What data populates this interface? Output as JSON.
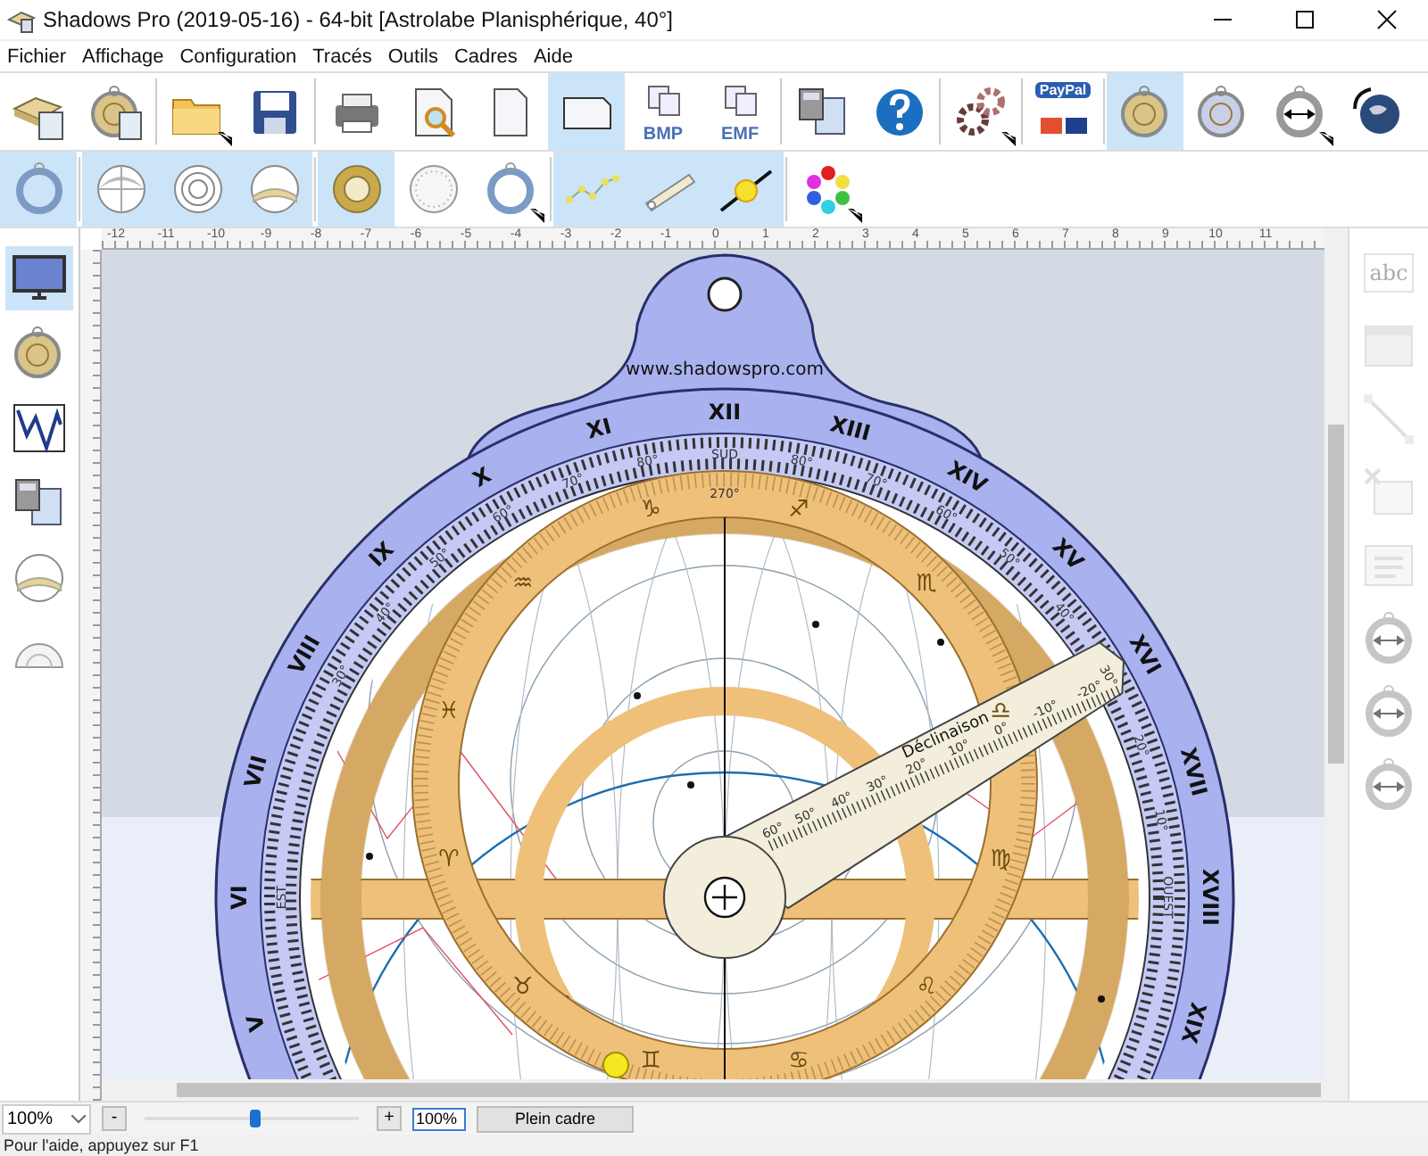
{
  "window": {
    "title": "Shadows Pro (2019-05-16) - 64-bit [Astrolabe Planisphérique, 40°]"
  },
  "menu": [
    "Fichier",
    "Affichage",
    "Configuration",
    "Tracés",
    "Outils",
    "Cadres",
    "Aide"
  ],
  "toolbar_main": [
    [
      {
        "kind": "new-stack",
        "selected": false,
        "dropdown": false
      },
      {
        "kind": "new-astrolabe",
        "selected": false,
        "dropdown": false
      }
    ],
    [
      {
        "kind": "open",
        "selected": false,
        "dropdown": true
      },
      {
        "kind": "save",
        "selected": false,
        "dropdown": false
      }
    ],
    [
      {
        "kind": "print",
        "selected": false,
        "dropdown": false
      },
      {
        "kind": "preview",
        "selected": false,
        "dropdown": false
      },
      {
        "kind": "page-portrait",
        "selected": false,
        "dropdown": false
      },
      {
        "kind": "page-landscape",
        "selected": true,
        "dropdown": false
      },
      {
        "kind": "export",
        "label": "BMP",
        "selected": false,
        "dropdown": false
      },
      {
        "kind": "export",
        "label": "EMF",
        "selected": false,
        "dropdown": false
      }
    ],
    [
      {
        "kind": "calculator",
        "selected": false,
        "dropdown": false
      },
      {
        "kind": "help",
        "selected": false,
        "dropdown": false
      }
    ],
    [
      {
        "kind": "settings",
        "selected": false,
        "dropdown": true
      }
    ],
    [
      {
        "kind": "donate",
        "label": "PayPal",
        "selected": false,
        "dropdown": false
      }
    ],
    [
      {
        "kind": "astrolabe-front",
        "selected": true,
        "dropdown": false
      },
      {
        "kind": "astrolabe-back",
        "selected": false,
        "dropdown": false
      },
      {
        "kind": "resize",
        "selected": false,
        "dropdown": true
      },
      {
        "kind": "globe",
        "selected": false,
        "dropdown": false
      }
    ]
  ],
  "toolbar_layers": [
    [
      {
        "kind": "ring",
        "selected": true,
        "dropdown": false
      }
    ],
    [
      {
        "kind": "hemisphere",
        "selected": true,
        "dropdown": false
      },
      {
        "kind": "circles",
        "selected": true,
        "dropdown": false
      },
      {
        "kind": "dome",
        "selected": true,
        "dropdown": false
      }
    ],
    [
      {
        "kind": "rete",
        "selected": true,
        "dropdown": false
      },
      {
        "kind": "disc",
        "selected": false,
        "dropdown": false
      },
      {
        "kind": "ring",
        "selected": false,
        "dropdown": true
      }
    ],
    [
      {
        "kind": "stars",
        "selected": true,
        "dropdown": false
      },
      {
        "kind": "rule",
        "selected": true,
        "dropdown": false
      },
      {
        "kind": "sun",
        "selected": true,
        "dropdown": false
      }
    ],
    [
      {
        "kind": "colors",
        "selected": false,
        "dropdown": true
      }
    ]
  ],
  "left_tools": [
    {
      "kind": "screen",
      "selected": true
    },
    {
      "kind": "astrolabe",
      "selected": false
    },
    {
      "kind": "wave",
      "selected": false
    },
    {
      "kind": "tables",
      "selected": false
    },
    {
      "kind": "dome",
      "selected": false
    },
    {
      "kind": "protractor",
      "selected": false
    }
  ],
  "right_tools": [
    {
      "kind": "text",
      "label": "abc",
      "disabled": true
    },
    {
      "kind": "image",
      "disabled": true
    },
    {
      "kind": "line",
      "disabled": true
    },
    {
      "kind": "delete",
      "disabled": true
    },
    {
      "kind": "list",
      "disabled": true
    },
    {
      "kind": "resize",
      "disabled": true
    },
    {
      "kind": "resize",
      "disabled": true
    },
    {
      "kind": "resize",
      "disabled": true
    }
  ],
  "ruler": {
    "labels": [
      "-12",
      "-11",
      "-10",
      "-9",
      "-8",
      "-7",
      "-6",
      "-5",
      "-4",
      "-3",
      "-2",
      "-1",
      "0",
      "1",
      "2",
      "3",
      "4",
      "5",
      "6",
      "7",
      "8",
      "9",
      "10",
      "11"
    ]
  },
  "astrolabe": {
    "website": "www.shadowspro.com",
    "hour_labels": [
      "V",
      "VI",
      "VII",
      "VIII",
      "IX",
      "X",
      "XI",
      "XII",
      "XIII",
      "XIV",
      "XV",
      "XVI",
      "XVII",
      "XVIII",
      "XIX"
    ],
    "left_altitudes": [
      "80°",
      "70°",
      "60°",
      "50°",
      "40°",
      "30°"
    ],
    "right_altitudes": [
      "80°",
      "70°",
      "60°",
      "50°",
      "40°",
      "30°",
      "20°",
      "10°"
    ],
    "south": "SUD",
    "east": "EST",
    "west": "OUEST",
    "ecliptic_label": "270°",
    "zodiac": [
      "♑",
      "♒",
      "♓",
      "♈",
      "♉",
      "♊",
      "♋",
      "♌",
      "♍",
      "♎",
      "♏",
      "♐"
    ],
    "rule_title": "Déclinaison",
    "rule_labels": [
      "60°",
      "50°",
      "40°",
      "30°",
      "20°",
      "10°",
      "0°",
      "-10°",
      "-20°"
    ]
  },
  "zoom_bar": {
    "zoom_select": "100%",
    "minus": "-",
    "slider": {
      "level": 0.52
    },
    "plus": "+",
    "zoom_value": "100%",
    "fit_button": "Plein cadre"
  },
  "status_bar": "Pour l'aide, appuyez sur F1"
}
